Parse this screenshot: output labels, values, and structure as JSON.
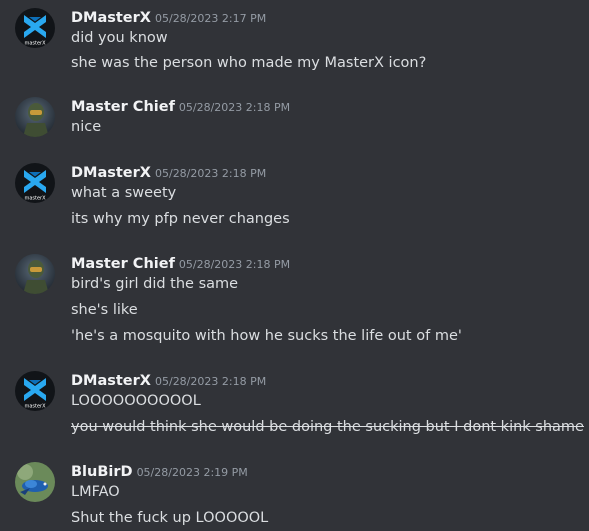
{
  "colors": {
    "background": "#313338",
    "username": "#f2f3f5",
    "timestamp": "#949ba4",
    "message_text": "#dbdee1"
  },
  "messages": [
    {
      "avatar": "masterx-logo-avatar",
      "username": "DMasterX",
      "timestamp": "05/28/2023 2:17 PM",
      "lines": [
        {
          "text": "did you know"
        },
        {
          "text": "she was the person who made my MasterX icon?"
        }
      ]
    },
    {
      "avatar": "master-chief-avatar",
      "username": "Master Chief",
      "timestamp": "05/28/2023 2:18 PM",
      "lines": [
        {
          "text": "nice"
        }
      ]
    },
    {
      "avatar": "masterx-logo-avatar",
      "username": "DMasterX",
      "timestamp": "05/28/2023 2:18 PM",
      "lines": [
        {
          "text": "what a sweety"
        },
        {
          "text": "its why my pfp never changes"
        }
      ]
    },
    {
      "avatar": "master-chief-avatar",
      "username": "Master Chief",
      "timestamp": "05/28/2023 2:18 PM",
      "lines": [
        {
          "text": "bird's girl did the same"
        },
        {
          "text": "she's like"
        },
        {
          "text": "'he's a mosquito with how he sucks the life out of me'"
        }
      ]
    },
    {
      "avatar": "masterx-logo-avatar",
      "username": "DMasterX",
      "timestamp": "05/28/2023 2:18 PM",
      "lines": [
        {
          "text": "LOOOOOOOOOOL"
        },
        {
          "text": "you would think she would be doing the sucking but I dont kink shame",
          "strikethrough": true
        }
      ]
    },
    {
      "avatar": "bird-avatar",
      "username": "BluBirD",
      "timestamp": "05/28/2023 2:19 PM",
      "lines": [
        {
          "text": "LMFAO"
        },
        {
          "text": "Shut the fuck up LOOOOOL"
        }
      ]
    }
  ]
}
